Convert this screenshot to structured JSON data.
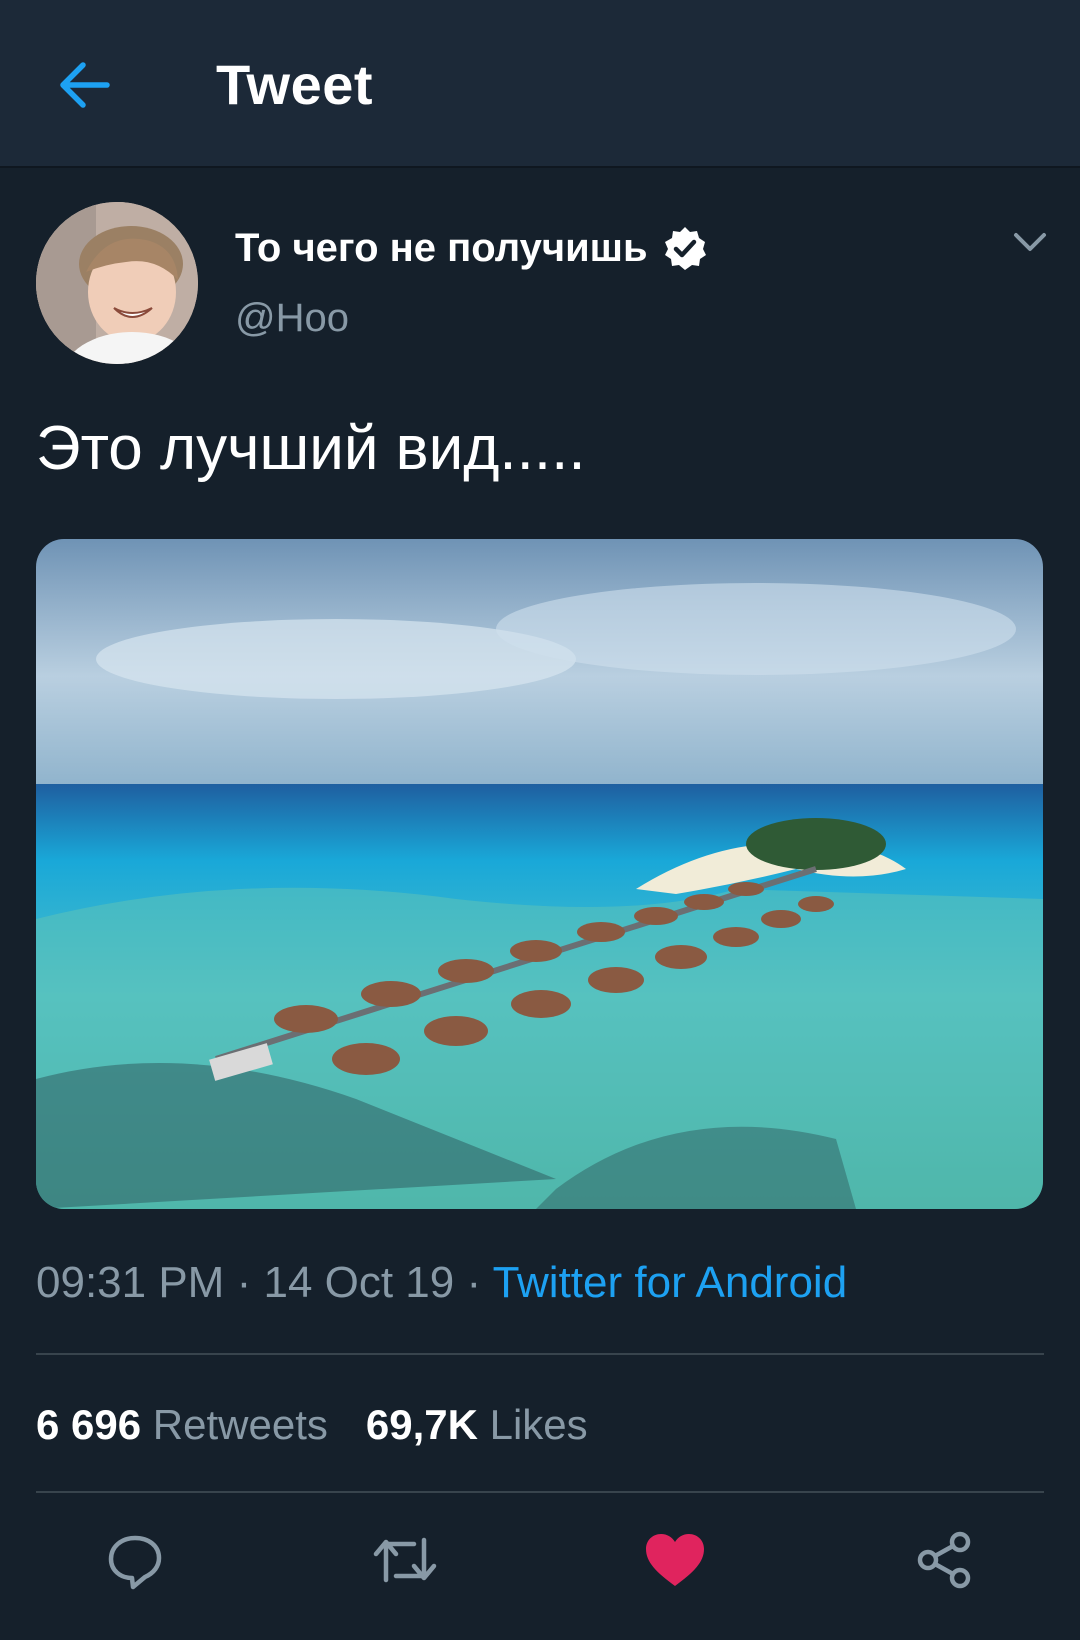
{
  "header": {
    "title": "Tweet",
    "back_icon": "arrow-left-icon"
  },
  "tweet": {
    "author": {
      "name": "То чего не получишь",
      "handle": "@Hoo",
      "verified": true
    },
    "text": "Это лучший вид.....",
    "time": "09:31 PM",
    "separator": "·",
    "date": "14 Oct 19",
    "source": "Twitter for Android",
    "stats": {
      "retweets_count": "6 696",
      "retweets_label": "Retweets",
      "likes_count": "69,7K",
      "likes_label": "Likes"
    }
  },
  "actions": [
    "reply-icon",
    "retweet-icon",
    "like-icon",
    "share-icon"
  ],
  "colors": {
    "accent": "#1da1f2",
    "like": "#e0245e",
    "background": "#15202b",
    "header": "#1c2938",
    "muted": "#8899a6"
  }
}
